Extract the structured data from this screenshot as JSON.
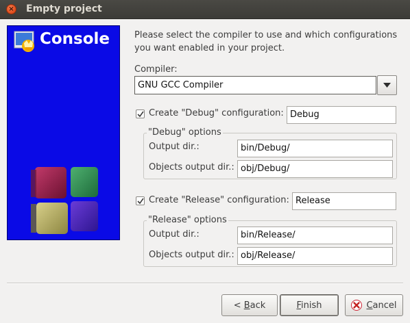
{
  "window": {
    "title": "Empty project"
  },
  "banner": {
    "title": "Console"
  },
  "intro": {
    "line1": "Please select the compiler to use and which configurations",
    "line2": "you want enabled in your project."
  },
  "compiler": {
    "label": "Compiler:",
    "value": "GNU GCC Compiler"
  },
  "debug": {
    "checkbox_label": "Create \"Debug\" configuration:",
    "checked": true,
    "name": "Debug",
    "group_title": "\"Debug\" options",
    "output_label": "Output dir.:",
    "output_value": "bin/Debug/",
    "objects_label": "Objects output dir.:",
    "objects_value": "obj/Debug/"
  },
  "release": {
    "checkbox_label": "Create \"Release\" configuration:",
    "checked": true,
    "name": "Release",
    "group_title": "\"Release\" options",
    "output_label": "Output dir.:",
    "output_value": "bin/Release/",
    "objects_label": "Objects output dir.:",
    "objects_value": "obj/Release/"
  },
  "buttons": {
    "back": {
      "prefix": "< ",
      "mnemonic": "B",
      "rest": "ack"
    },
    "finish": {
      "mnemonic": "F",
      "rest": "inish"
    },
    "cancel": {
      "mnemonic": "C",
      "rest": "ancel"
    }
  },
  "colors": {
    "banner_bg": "#0a0ae6",
    "titlebar_bg": "#3c3b37",
    "close_button": "#de4a1a"
  }
}
